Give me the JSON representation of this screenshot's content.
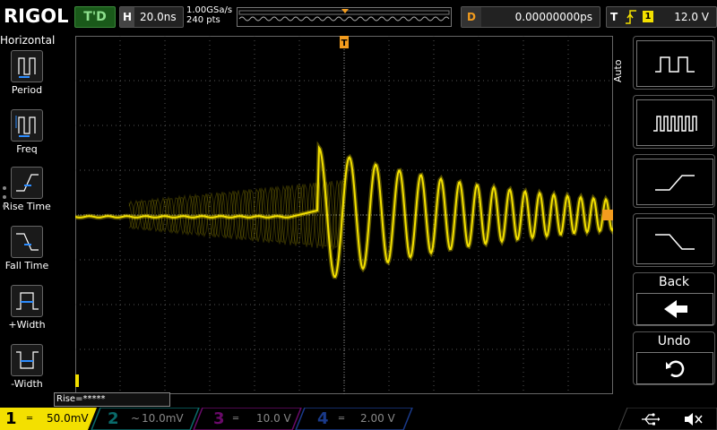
{
  "brand": "RIGOL",
  "status": "T'D",
  "horizontal": {
    "label": "H",
    "timebase": "20.0ns",
    "sample_rate": "1.00GSa/s",
    "mem_depth": "240 pts"
  },
  "delay": {
    "label": "D",
    "value": "0.00000000ps"
  },
  "trigger": {
    "label": "T",
    "source": "1",
    "level": "12.0 V"
  },
  "left_menu": {
    "title": "Horizontal",
    "items": [
      {
        "label": "Period",
        "icon": "period-icon"
      },
      {
        "label": "Freq",
        "icon": "freq-icon"
      },
      {
        "label": "Rise Time",
        "icon": "rise-time-icon"
      },
      {
        "label": "Fall Time",
        "icon": "fall-time-icon"
      },
      {
        "label": "+Width",
        "icon": "positive-width-icon"
      },
      {
        "label": "-Width",
        "icon": "negative-width-icon"
      }
    ]
  },
  "measurement": {
    "text": "Rise=*****"
  },
  "right_menu": {
    "mode": "Auto",
    "buttons": [
      {
        "icon": "square-wave-icon"
      },
      {
        "icon": "pulse-train-icon"
      },
      {
        "icon": "rising-edge-icon"
      },
      {
        "icon": "falling-edge-icon"
      },
      {
        "label": "Back",
        "icon": "back-arrow-icon"
      },
      {
        "label": "Undo",
        "icon": "undo-icon"
      }
    ]
  },
  "channels": [
    {
      "num": "1",
      "coupling": "═",
      "scale": "50.0mV",
      "color": "#f3e000",
      "active": true
    },
    {
      "num": "2",
      "coupling": "~",
      "scale": "10.0mV",
      "color": "#00c8c8",
      "active": false
    },
    {
      "num": "3",
      "coupling": "═",
      "scale": "10.0 V",
      "color": "#d000d0",
      "active": false
    },
    {
      "num": "4",
      "coupling": "═",
      "scale": "2.00 V",
      "color": "#2060ff",
      "active": false
    }
  ],
  "colors": {
    "trace": "#f3e000",
    "trigger_marker": "#f39c1e",
    "grid": "#555555"
  }
}
